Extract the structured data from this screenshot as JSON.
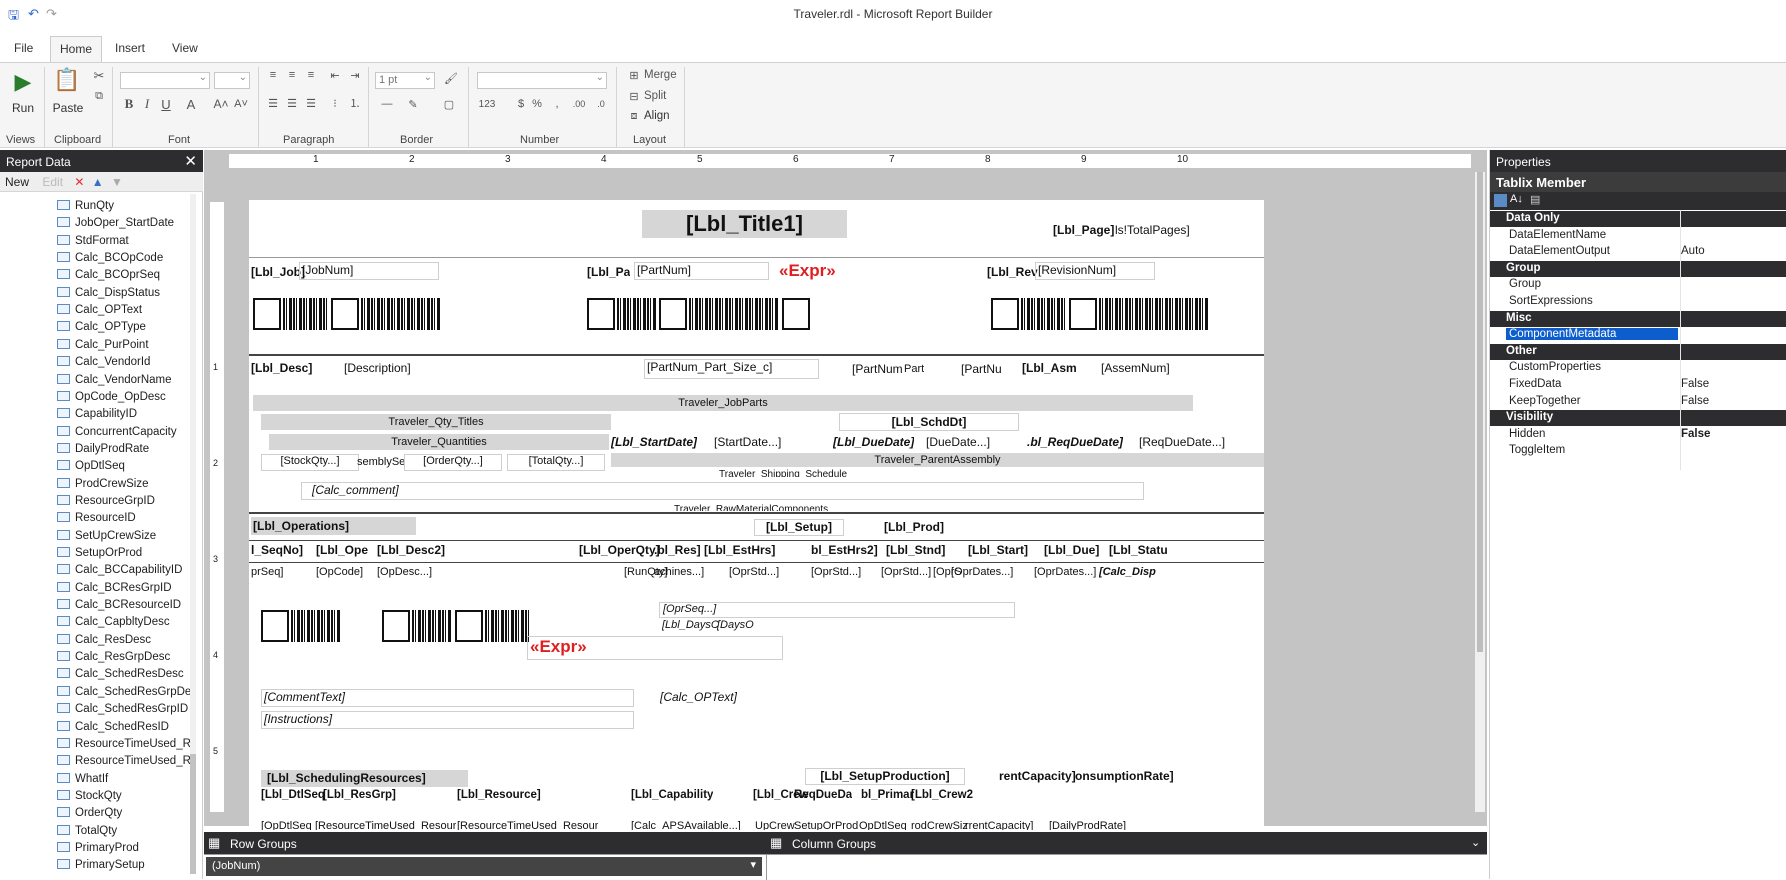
{
  "window": {
    "title": "Traveler.rdl - Microsoft Report Builder"
  },
  "tabs": [
    "File",
    "Home",
    "Insert",
    "View"
  ],
  "ribbon": {
    "groups": [
      "Views",
      "Clipboard",
      "Font",
      "Paragraph",
      "Border",
      "Number",
      "Layout"
    ],
    "run": "Run",
    "paste": "Paste",
    "border_width": "1 pt",
    "merge": "Merge",
    "split": "Split",
    "align": "Align"
  },
  "report_data": {
    "title": "Report Data",
    "new": "New",
    "edit": "Edit",
    "fields": [
      "RunQty",
      "JobOper_StartDate",
      "StdFormat",
      "Calc_BCOpCode",
      "Calc_BCOprSeq",
      "Calc_DispStatus",
      "Calc_OPText",
      "Calc_OPType",
      "Calc_PurPoint",
      "Calc_VendorId",
      "Calc_VendorName",
      "OpCode_OpDesc",
      "CapabilityID",
      "ConcurrentCapacity",
      "DailyProdRate",
      "OpDtlSeq",
      "ProdCrewSize",
      "ResourceGrpID",
      "ResourceID",
      "SetUpCrewSize",
      "SetupOrProd",
      "Calc_BCCapabilityID",
      "Calc_BCResGrpID",
      "Calc_BCResourceID",
      "Calc_CapbltyDesc",
      "Calc_ResDesc",
      "Calc_ResGrpDesc",
      "Calc_SchedResDesc",
      "Calc_SchedResGrpDe",
      "Calc_SchedResGrpID",
      "Calc_SchedResID",
      "ResourceTimeUsed_R",
      "ResourceTimeUsed_R",
      "WhatIf",
      "StockQty",
      "OrderQty",
      "TotalQty",
      "PrimaryProd",
      "PrimarySetup"
    ]
  },
  "report": {
    "title": "[Lbl_Title1]",
    "page": "[Lbl_Page]",
    "total_pages": "ls!TotalPages]",
    "lbl_job": "[Lbl_Job]",
    "job_num": "[JobNum]",
    "lbl_pa": "[Lbl_Pa",
    "part_num": "[PartNum]",
    "expr": "«Expr»",
    "lbl_rev": "[Lbl_Rev",
    "revision_num": "[RevisionNum]",
    "lbl_desc": "[Lbl_Desc]",
    "description": "[Description]",
    "part_size": "[PartNum_Part_Size_c]",
    "part_num2": "[PartNum",
    "part_t": "Part",
    "part_num3": "[PartNu",
    "lbl_dasm": "[Lbl_Asm",
    "asm_num": "[AssemNum]",
    "jobparts": "Traveler_JobParts",
    "qty_titles": "Traveler_Qty_Titles",
    "sched_dt": "[Lbl_SchdDt]",
    "quantities": "Traveler_Quantities",
    "lbl_start": "[Lbl_StartDate]",
    "start_date": "[StartDate...]",
    "lbl_due": "[Lbl_DueDate]",
    "due_date": "[DueDate...]",
    "lbl_req": ".bl_ReqDueDate]",
    "req_due": "[ReqDueDate...]",
    "stock_qty": "[StockQty...]",
    "assembly_seq": "semblySe",
    "order_qty": "[OrderQty...]",
    "total_qty": "[TotalQty...]",
    "parent_asm": "Traveler_ParentAssembly",
    "shipping": "Traveler_Shipping_Schedule",
    "calc_comment": "[Calc_comment]",
    "raw_material": "Traveler_RawMaterialComponents",
    "operations": "[Lbl_Operations]",
    "lbl_setup": "[Lbl_Setup]",
    "lbl_prod": "[Lbl_Prod]",
    "op_headers": [
      "l_SeqNo]",
      "[Lbl_Ope",
      "[Lbl_Desc2]",
      "[Lbl_OperQty]",
      ".bl_Res]",
      "[Lbl_EstHrs]",
      "bl_EstHrs2]",
      "[Lbl_Stnd]",
      "[Lbl_Start]",
      "[Lbl_Due]",
      "[Lbl_Statu"
    ],
    "op_values": [
      "prSeq]",
      "[OpCode]",
      "[OpDesc...]",
      "[RunQty]",
      "achines...]",
      "[OprStd...]",
      "[OprStd...]",
      "[OprStd...]",
      "[OprS",
      "[OprDates...]",
      "[OprDates...]",
      "[Calc_Disp"
    ],
    "opr_seq": "[OprSeq...]",
    "lbl_days": "[Lbl_DaysC",
    "days": "[DaysO",
    "expr2": "«Expr»",
    "comment_text": "[CommentText]",
    "instructions": "[Instructions]",
    "calc_optext": "[Calc_OPText]",
    "sched_res": "[Lbl_SchedulingResources]",
    "setup_prod": "[Lbl_SetupProduction]",
    "rent_cap": "rentCapacity]",
    "consumption": "onsumptionRate]",
    "res_headers": [
      "[Lbl_DtlSeq",
      "[Lbl_ResGrp]",
      "[Lbl_Resource]",
      "[Lbl_Capability",
      "[Lbl_Crew",
      "ReqDueDa",
      "bl_Primar",
      "[Lbl_Crew2"
    ],
    "res_values": [
      "[OpDtlSeq",
      "[ResourceTimeUsed_Resour",
      "[ResourceTimeUsed_Resour",
      "[Calc_APSAvailable...]",
      "UpCrew",
      "SetupOrProd",
      "OpDtlSeq",
      "rodCrewSiz",
      "rrentCapacity]",
      "[DailyProdRate]"
    ]
  },
  "ruler": [
    "1",
    "2",
    "3",
    "4",
    "5",
    "6",
    "7",
    "8",
    "9",
    "10"
  ],
  "ruler_v": [
    "1",
    "2",
    "3",
    "4",
    "5"
  ],
  "groups": {
    "row": "Row Groups",
    "column": "Column Groups",
    "row_item": "(JobNum)"
  },
  "properties": {
    "title": "Properties",
    "subject": "Tablix Member",
    "rows": [
      {
        "name": "Data Only",
        "value": "",
        "type": "cat"
      },
      {
        "name": "DataElementName",
        "value": "",
        "type": "item"
      },
      {
        "name": "DataElementOutput",
        "value": "Auto",
        "type": "item"
      },
      {
        "name": "Group",
        "value": "",
        "type": "cat"
      },
      {
        "name": "Group",
        "value": "",
        "type": "item"
      },
      {
        "name": "SortExpressions",
        "value": "",
        "type": "item"
      },
      {
        "name": "Misc",
        "value": "",
        "type": "cat"
      },
      {
        "name": "ComponentMetadata",
        "value": "",
        "type": "sel"
      },
      {
        "name": "Other",
        "value": "",
        "type": "cat"
      },
      {
        "name": "CustomProperties",
        "value": "",
        "type": "item"
      },
      {
        "name": "FixedData",
        "value": "False",
        "type": "item"
      },
      {
        "name": "KeepTogether",
        "value": "False",
        "type": "item"
      },
      {
        "name": "Visibility",
        "value": "",
        "type": "cat"
      },
      {
        "name": "Hidden",
        "value": "False",
        "type": "item"
      },
      {
        "name": "ToggleItem",
        "value": "",
        "type": "item"
      }
    ]
  }
}
